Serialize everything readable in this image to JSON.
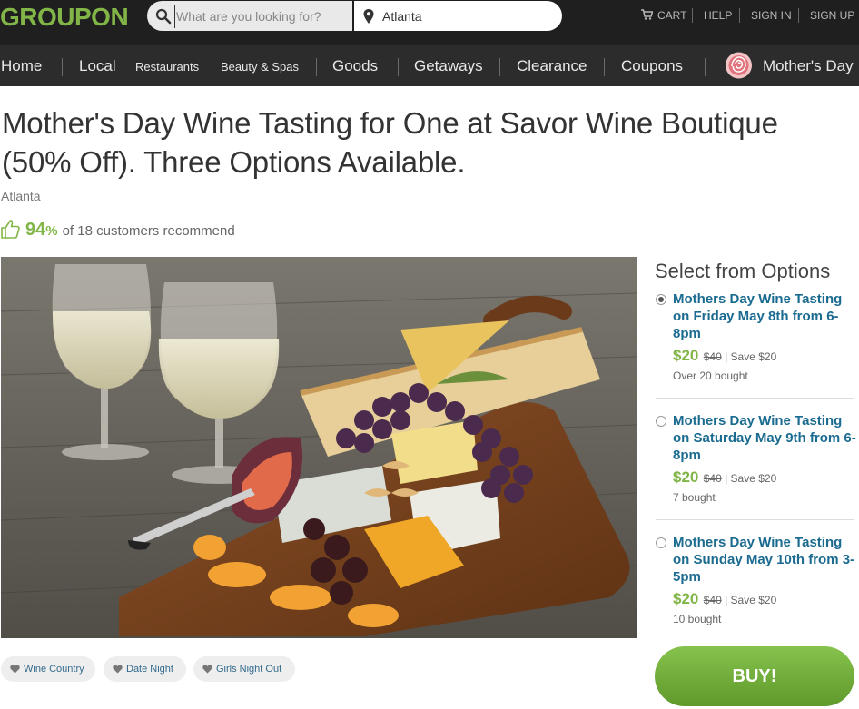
{
  "brand": {
    "logo_text": "GROUPON",
    "accent": "#82b548"
  },
  "search": {
    "placeholder": "What are you looking for?",
    "value": ""
  },
  "location": {
    "value": "Atlanta"
  },
  "util": {
    "cart": "CART",
    "help": "HELP",
    "sign_in": "SIGN IN",
    "sign_up": "SIGN UP"
  },
  "nav": {
    "home": "Home",
    "local": "Local",
    "restaurants": "Restaurants",
    "beauty": "Beauty & Spas",
    "goods": "Goods",
    "getaways": "Getaways",
    "clearance": "Clearance",
    "coupons": "Coupons",
    "mothers_day": "Mother's Day"
  },
  "deal": {
    "title": "Mother's Day Wine Tasting for One at Savor Wine Boutique (50% Off). Three Options Available.",
    "city": "Atlanta",
    "recommend_pct": "94",
    "recommend_pct_symbol": "%",
    "recommend_text": "of 18 customers recommend"
  },
  "tags": [
    "Wine Country",
    "Date Night",
    "Girls Night Out"
  ],
  "options": {
    "heading": "Select from Options",
    "items": [
      {
        "name": "Mothers Day Wine Tasting on Friday May 8th from 6-8pm",
        "price": "$20",
        "was": "$40",
        "save": "Save $20",
        "bought": "Over 20 bought",
        "selected": true
      },
      {
        "name": "Mothers Day Wine Tasting on Saturday May 9th from 6-8pm",
        "price": "$20",
        "was": "$40",
        "save": "Save $20",
        "bought": "7 bought",
        "selected": false
      },
      {
        "name": "Mothers Day Wine Tasting on Sunday May 10th from 3-5pm",
        "price": "$20",
        "was": "$40",
        "save": "Save $20",
        "bought": "10 bought",
        "selected": false
      }
    ]
  },
  "buy_label": "BUY!"
}
